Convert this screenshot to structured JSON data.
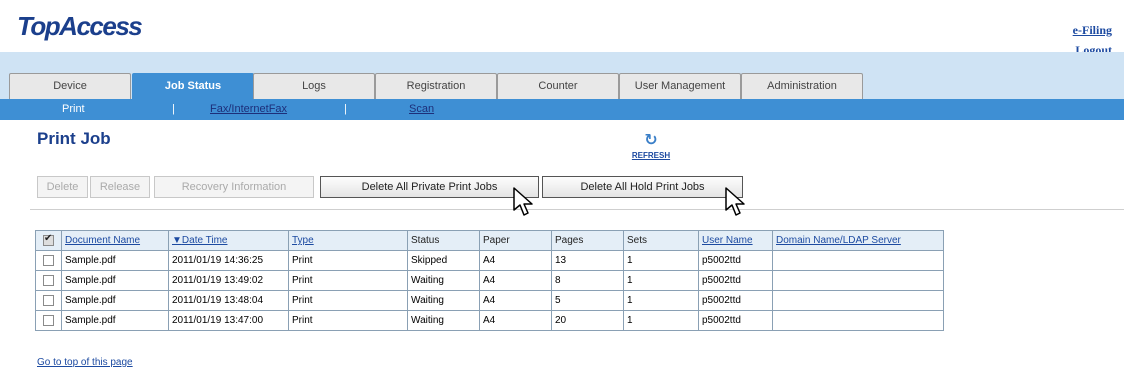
{
  "app": {
    "logo": "TopAccess"
  },
  "header_links": {
    "efiling": "e-Filing",
    "logout": "Logout"
  },
  "tabs": [
    {
      "label": "Device",
      "active": false
    },
    {
      "label": "Job Status",
      "active": true
    },
    {
      "label": "Logs",
      "active": false
    },
    {
      "label": "Registration",
      "active": false
    },
    {
      "label": "Counter",
      "active": false
    },
    {
      "label": "User Management",
      "active": false
    },
    {
      "label": "Administration",
      "active": false
    }
  ],
  "subnav": {
    "print": "Print",
    "fax": "Fax/InternetFax",
    "scan": "Scan",
    "sep": "|"
  },
  "page": {
    "title": "Print Job",
    "refresh_label": "REFRESH"
  },
  "toolbar": {
    "delete": "Delete",
    "release": "Release",
    "recovery": "Recovery Information",
    "delete_private": "Delete All Private Print Jobs",
    "delete_hold": "Delete All Hold Print Jobs"
  },
  "table": {
    "headers": [
      "Document Name",
      "Date Time",
      "Type",
      "Status",
      "Paper",
      "Pages",
      "Sets",
      "User Name",
      "Domain Name/LDAP Server"
    ],
    "rows": [
      [
        "Sample.pdf",
        "2011/01/19 14:36:25",
        "Print",
        "Skipped",
        "A4",
        "13",
        "1",
        "p5002ttd",
        ""
      ],
      [
        "Sample.pdf",
        "2011/01/19 13:49:02",
        "Print",
        "Waiting",
        "A4",
        "8",
        "1",
        "p5002ttd",
        ""
      ],
      [
        "Sample.pdf",
        "2011/01/19 13:48:04",
        "Print",
        "Waiting",
        "A4",
        "5",
        "1",
        "p5002ttd",
        ""
      ],
      [
        "Sample.pdf",
        "2011/01/19 13:47:00",
        "Print",
        "Waiting",
        "A4",
        "20",
        "1",
        "p5002ttd",
        ""
      ]
    ]
  },
  "footer": {
    "top_link": "Go to top of this page"
  },
  "colors": {
    "brand": "#1b3f8c",
    "tab_active": "#3e8fd4",
    "tab_bar": "#cfe3f4",
    "link": "#1c4aa1"
  }
}
